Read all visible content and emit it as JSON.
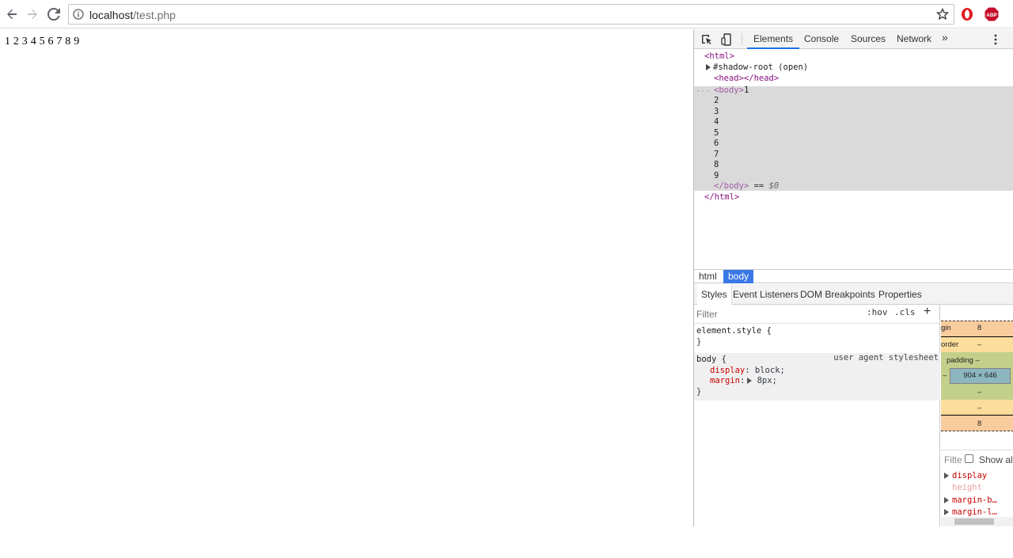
{
  "browser": {
    "url_host": "localhost",
    "url_path": "/test.php"
  },
  "page": {
    "text": "1 2 3 4 5 6 7 8 9"
  },
  "devtools": {
    "tabs": [
      "Elements",
      "Console",
      "Sources",
      "Network"
    ],
    "more_tabs": "»",
    "dom_tree": {
      "html_open": "<html>",
      "shadow_root": "#shadow-root (open)",
      "head": "<head></head>",
      "body_open": "<body>",
      "body_first": "1",
      "body_lines": [
        "2",
        "3",
        "4",
        "5",
        "6",
        "7",
        "8",
        "9"
      ],
      "body_close": "</body>",
      "eq_marker": " == ",
      "dollar0": "$0",
      "html_close": "</html>",
      "ellipsis": "···"
    },
    "breadcrumb": [
      "html",
      "body"
    ],
    "sub_tabs": [
      "Styles",
      "Event Listeners",
      "DOM Breakpoints",
      "Properties"
    ],
    "styles": {
      "filter_placeholder": "Filter",
      "hov": ":hov",
      "cls": ".cls",
      "plus": "+",
      "element_style_open": "element.style {",
      "close_brace": "}",
      "body_selector": "body {",
      "source": "user agent stylesheet",
      "declarations": [
        {
          "prop": "display",
          "value": " block;"
        },
        {
          "prop": "margin",
          "value": " 8px;"
        }
      ]
    },
    "box_model": {
      "margin_label": "gin",
      "margin_value": "8",
      "border_label": "order",
      "border_value": "–",
      "padding_label": "padding –",
      "content_size": "904 × 646",
      "left_dash": "–",
      "padding_bottom": "–",
      "border_bottom": "–",
      "margin_bottom": "8"
    },
    "computed": {
      "filter_label": "Filte",
      "show_all": "Show all",
      "props": [
        {
          "name": "display",
          "expandable": true,
          "faded": false
        },
        {
          "name": "height",
          "expandable": false,
          "faded": true
        },
        {
          "name": "margin-b…",
          "expandable": true,
          "faded": false
        },
        {
          "name": "margin-l…",
          "expandable": true,
          "faded": false
        }
      ]
    }
  },
  "colors": {
    "accent": "#1a73e8",
    "crumb_active": "#3b78e7",
    "tag": "#881280",
    "prop": "#c80000",
    "opera_red": "#e11b22",
    "abp_red": "#c70d2c"
  },
  "icons": [
    "back-arrow-icon",
    "forward-arrow-icon",
    "reload-icon",
    "info-icon",
    "star-icon",
    "opera-icon",
    "adblock-plus-icon",
    "inspect-element-icon",
    "device-toolbar-icon",
    "kebab-menu-icon"
  ]
}
